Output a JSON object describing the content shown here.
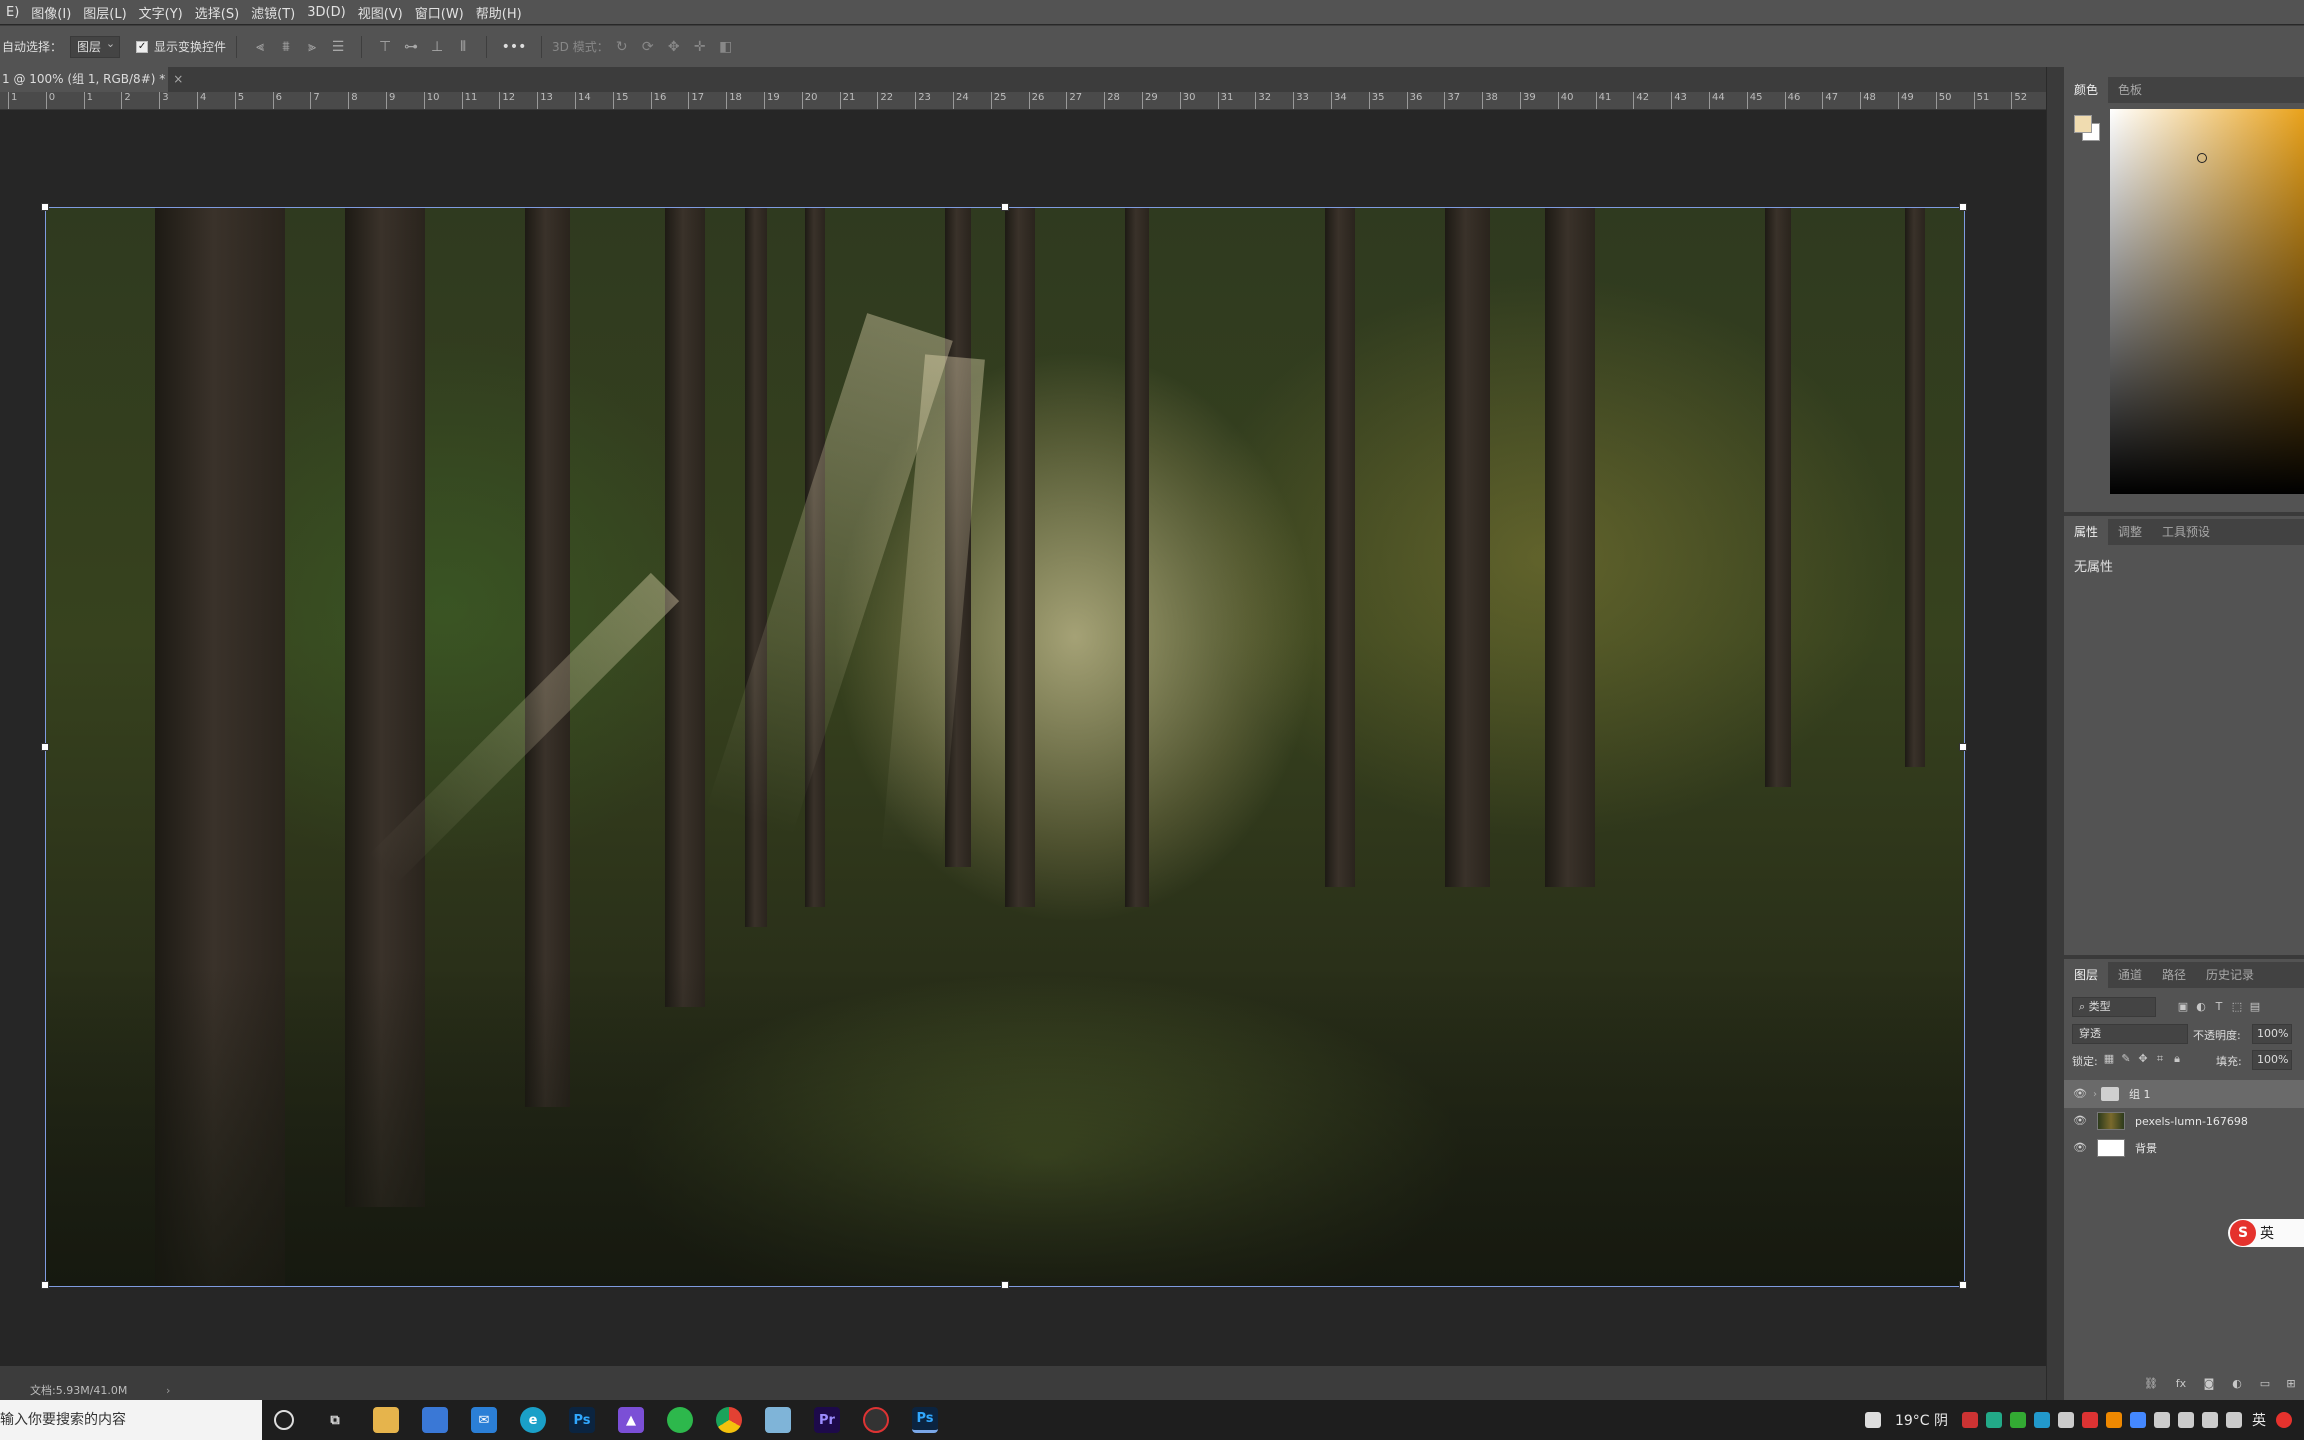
{
  "menubar": {
    "items": [
      "E)",
      "图像(I)",
      "图层(L)",
      "文字(Y)",
      "选择(S)",
      "滤镜(T)",
      "3D(D)",
      "视图(V)",
      "窗口(W)",
      "帮助(H)"
    ]
  },
  "options": {
    "auto_select_label": "自动选择：",
    "auto_select_value": "图层",
    "show_transform_label": "显示变换控件",
    "mode_3d_label": "3D 模式：",
    "more_label": "•••"
  },
  "document": {
    "tab_title": "1 @ 100% (组 1, RGB/8#) *",
    "close": "×"
  },
  "ruler": {
    "ticks": [
      "1",
      "0",
      "1",
      "2",
      "3",
      "4",
      "5",
      "6",
      "7",
      "8",
      "9",
      "10",
      "11",
      "12",
      "13",
      "14",
      "15",
      "16",
      "17",
      "18",
      "19",
      "20",
      "21",
      "22",
      "23",
      "24",
      "25",
      "26",
      "27",
      "28",
      "29",
      "30",
      "31",
      "32",
      "33",
      "34",
      "35",
      "36",
      "37",
      "38",
      "39",
      "40",
      "41",
      "42",
      "43",
      "44",
      "45",
      "46",
      "47",
      "48",
      "49",
      "50",
      "51",
      "52"
    ]
  },
  "status": {
    "doc_info": "文档:5.93M/41.0M",
    "arrow": "›"
  },
  "panels": {
    "color_tabs": [
      "颜色",
      "色板"
    ],
    "props_tabs": [
      "属性",
      "调整",
      "工具预设"
    ],
    "no_props": "无属性",
    "layers_tabs": [
      "图层",
      "通道",
      "路径",
      "历史记录"
    ],
    "filter_kind": "类型",
    "blend_mode": "穿透",
    "opacity_label": "不透明度:",
    "opacity_value": "100%",
    "lock_label": "锁定:",
    "fill_label": "填充:",
    "fill_value": "100%"
  },
  "layers": [
    {
      "name": "组 1",
      "type": "group",
      "selected": true
    },
    {
      "name": "pexels-lumn-167698",
      "type": "smart",
      "selected": false
    },
    {
      "name": "背景",
      "type": "background",
      "selected": false
    }
  ],
  "ime": {
    "label": "英"
  },
  "taskbar": {
    "search_placeholder": "输入你要搜索的内容",
    "apps": [
      "cortana-icon",
      "task-view-icon",
      "file-explorer-icon",
      "store-icon",
      "mail-icon",
      "edge-icon",
      "photoshop-icon",
      "app-icon",
      "wechat-icon",
      "chrome-icon",
      "notes-icon",
      "premiere-icon",
      "recorder-icon",
      "photoshop-active-icon"
    ],
    "weather": "19°C 阴",
    "lang": "英"
  },
  "colors": {
    "accent_selection": "#7f9be0",
    "picker_hue": "#e9a21b",
    "foreground": "#f0dcb0"
  }
}
